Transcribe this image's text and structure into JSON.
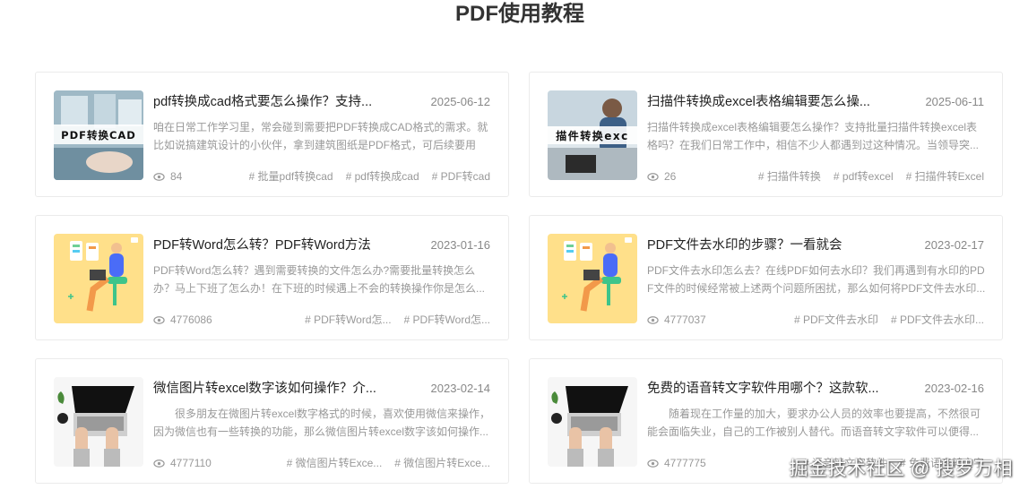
{
  "page": {
    "title": "PDF使用教程"
  },
  "watermark": "掘金技术社区 @ 搜罗万相",
  "cards": [
    {
      "title": "pdf转换成cad格式要怎么操作？支持...",
      "date": "2025-06-12",
      "desc": "咱在日常工作学习里，常会碰到需要把PDF转换成CAD格式的需求。就比如说搞建筑设计的小伙伴，拿到建筑图纸是PDF格式，可后续要用C...",
      "views": "84",
      "tags": [
        "# 批量pdf转换cad",
        "# pdf转换成cad",
        "# PDF转cad"
      ],
      "thumb_type": "photo",
      "thumb_text": "PDF转换CAD",
      "thumb_icon": "cad-conversion-thumbnail"
    },
    {
      "title": "扫描件转换成excel表格编辑要怎么操...",
      "date": "2025-06-11",
      "desc": "扫描件转换成excel表格编辑要怎么操作？支持批量扫描件转换excel表格吗？在我们日常工作中，相信不少人都遇到过这种情况。当领导突...",
      "views": "26",
      "tags": [
        "# 扫描件转换",
        "# pdf转excel",
        "# 扫描件转Excel"
      ],
      "thumb_type": "photo2",
      "thumb_text": "描件转换exc",
      "thumb_icon": "scan-to-excel-thumbnail"
    },
    {
      "title": "PDF转Word怎么转？PDF转Word方法",
      "date": "2023-01-16",
      "desc": "PDF转Word怎么转？遇到需要转换的文件怎么办?需要批量转换怎么办？马上下班了怎么办！在下班的时候遇上不会的转换操作你是怎么...",
      "views": "4776086",
      "tags": [
        "# PDF转Word怎...",
        "# PDF转Word怎..."
      ],
      "thumb_type": "illustration",
      "thumb_text": "",
      "thumb_icon": "person-laptop-illustration"
    },
    {
      "title": "PDF文件去水印的步骤？一看就会",
      "date": "2023-02-17",
      "desc": "PDF文件去水印怎么去？在线PDF如何去水印？我们再遇到有水印的PDF文件的时候经常被上述两个问题所困扰，那么如何将PDF文件去水印...",
      "views": "4777037",
      "tags": [
        "# PDF文件去水印",
        "# PDF文件去水印..."
      ],
      "thumb_type": "illustration",
      "thumb_text": "",
      "thumb_icon": "person-laptop-illustration"
    },
    {
      "title": "微信图片转excel数字该如何操作？介...",
      "date": "2023-02-14",
      "desc": "很多朋友在微图片转excel数字格式的时候，喜欢使用微信来操作，因为微信也有一些转换的功能，那么微信图片转excel数字该如何操作...",
      "views": "4777110",
      "tags": [
        "# 微信图片转Exce...",
        "# 微信图片转Exce..."
      ],
      "thumb_type": "laptop",
      "thumb_text": "",
      "thumb_icon": "hands-laptop-thumbnail"
    },
    {
      "title": "免费的语音转文字软件用哪个？这款软...",
      "date": "2023-02-16",
      "desc": "随着现在工作量的加大，要求办公人员的效率也要提高，不然很可能会面临失业，自己的工作被别人替代。而语音转文字软件可以便得...",
      "views": "4777775",
      "tags": [
        "# 语音转文字软件",
        "# 免费语音转文字"
      ],
      "thumb_type": "laptop",
      "thumb_text": "",
      "thumb_icon": "hands-laptop-thumbnail"
    }
  ],
  "colors": {
    "title": "#333333",
    "meta": "#999999",
    "border": "#ebebeb"
  }
}
